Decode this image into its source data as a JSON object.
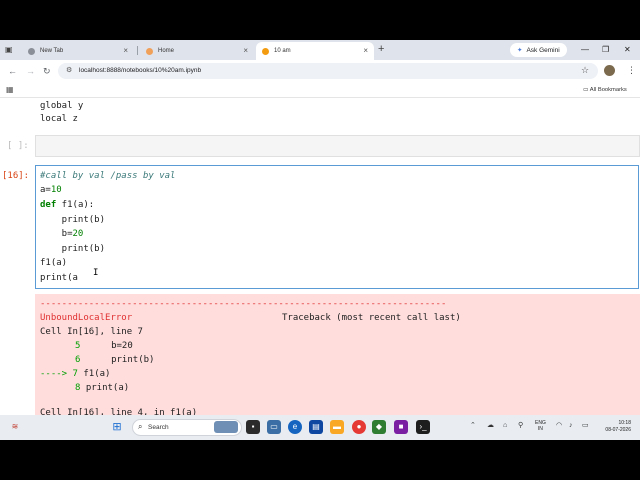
{
  "browser": {
    "tabs": [
      {
        "label": "New Tab",
        "active": false
      },
      {
        "label": "Home",
        "active": false
      },
      {
        "label": "10 am",
        "active": true
      }
    ],
    "new_tab_symbol": "+",
    "ask_gemini": "Ask Gemini",
    "url": "localhost:8888/notebooks/10%20am.ipynb",
    "all_bookmarks": "All Bookmarks",
    "accent_color": "#5a9bd5"
  },
  "notebook": {
    "prev_output": [
      "global y",
      "local z"
    ],
    "empty_prompt": "[ ]:",
    "cell_prompt": "[16]:",
    "code": {
      "comment": "#call by val /pass by val",
      "l2_var": "a=",
      "l2_num": "10",
      "l3_kw": "def",
      "l3_rest": " f1(a):",
      "l4": "    print(b)",
      "l5_var": "    b=",
      "l5_num": "20",
      "l6": "    print(b)",
      "l7": "f1(a)",
      "l8": "print(a"
    },
    "error": {
      "dashes": "---------------------------------------------------------------------------",
      "name": "UnboundLocalError",
      "traceback": "Traceback (most recent call last)",
      "cell_line_a": "Cell In[16], line 7",
      "row1_num": "5",
      "row1_code": "    b=20",
      "row2_num": "6",
      "row2_code": "    print(b)",
      "arrow": "----> 7",
      "row3_code": " f1(a)",
      "row4_num": "8",
      "row4_code": " print(a)",
      "cell_line_b": "Cell In[16], line 4, in f1(a)"
    }
  },
  "taskbar": {
    "search_label": "Search",
    "lang_top": "ENG",
    "lang_bottom": "IN",
    "time": "10:18",
    "date": "08-07-2026"
  }
}
